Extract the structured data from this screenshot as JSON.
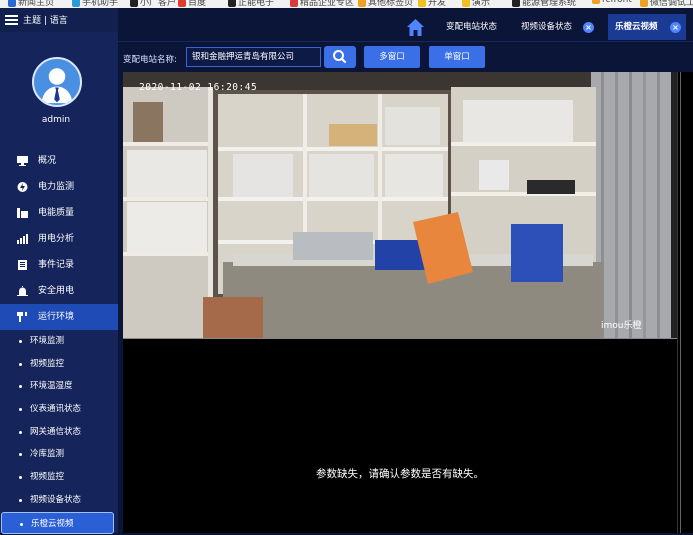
{
  "bookmarks": [
    {
      "label": "新闻主页",
      "color": "#2a6ad8"
    },
    {
      "label": "手机助手",
      "color": "#2a9ad8"
    },
    {
      "label": "小厂客户",
      "color": "#222222"
    },
    {
      "label": "百度",
      "color": "#e03b2f"
    },
    {
      "label": "正能电子",
      "color": "#222222"
    },
    {
      "label": "精品企业专区",
      "color": "#d83b3b"
    },
    {
      "label": "其他标签页",
      "color": "#f0a020"
    },
    {
      "label": "开发",
      "color": "#f0c020"
    },
    {
      "label": "演示",
      "color": "#f0c020"
    },
    {
      "label": "能源管理系统",
      "color": "#222222"
    },
    {
      "label": "rcfront",
      "color": "#f0a020"
    },
    {
      "label": "微信调试工具",
      "color": "#f0a020"
    }
  ],
  "header": {
    "topic_lang": "主题 | 语言"
  },
  "user": {
    "name": "admin"
  },
  "menu": [
    {
      "label": "概况"
    },
    {
      "label": "电力监测"
    },
    {
      "label": "电能质量"
    },
    {
      "label": "用电分析"
    },
    {
      "label": "事件记录"
    },
    {
      "label": "安全用电"
    },
    {
      "label": "运行环境"
    }
  ],
  "submenu": [
    {
      "label": "环境监测"
    },
    {
      "label": "视频监控"
    },
    {
      "label": "环境温湿度"
    },
    {
      "label": "仪表通讯状态"
    },
    {
      "label": "网关通信状态"
    },
    {
      "label": "冷库监测"
    },
    {
      "label": "视频监控"
    },
    {
      "label": "视频设备状态"
    },
    {
      "label": "乐橙云视频"
    }
  ],
  "tabs": [
    {
      "label": "变配电站状态"
    },
    {
      "label": "视频设备状态"
    },
    {
      "label": "乐橙云视频"
    }
  ],
  "filter": {
    "label": "变配电站名称:",
    "value": "银和金融押运青岛有限公司",
    "btn_multi": "多窗口",
    "btn_single": "单窗口"
  },
  "video": {
    "timestamp": "2020-11-02 16:20:45",
    "watermark": "imou乐橙"
  },
  "message": "参数缺失，请确认参数是否有缺失。",
  "colors": {
    "accent": "#3a6fe8",
    "sidebar": "#15245a",
    "page": "#0b1537"
  }
}
